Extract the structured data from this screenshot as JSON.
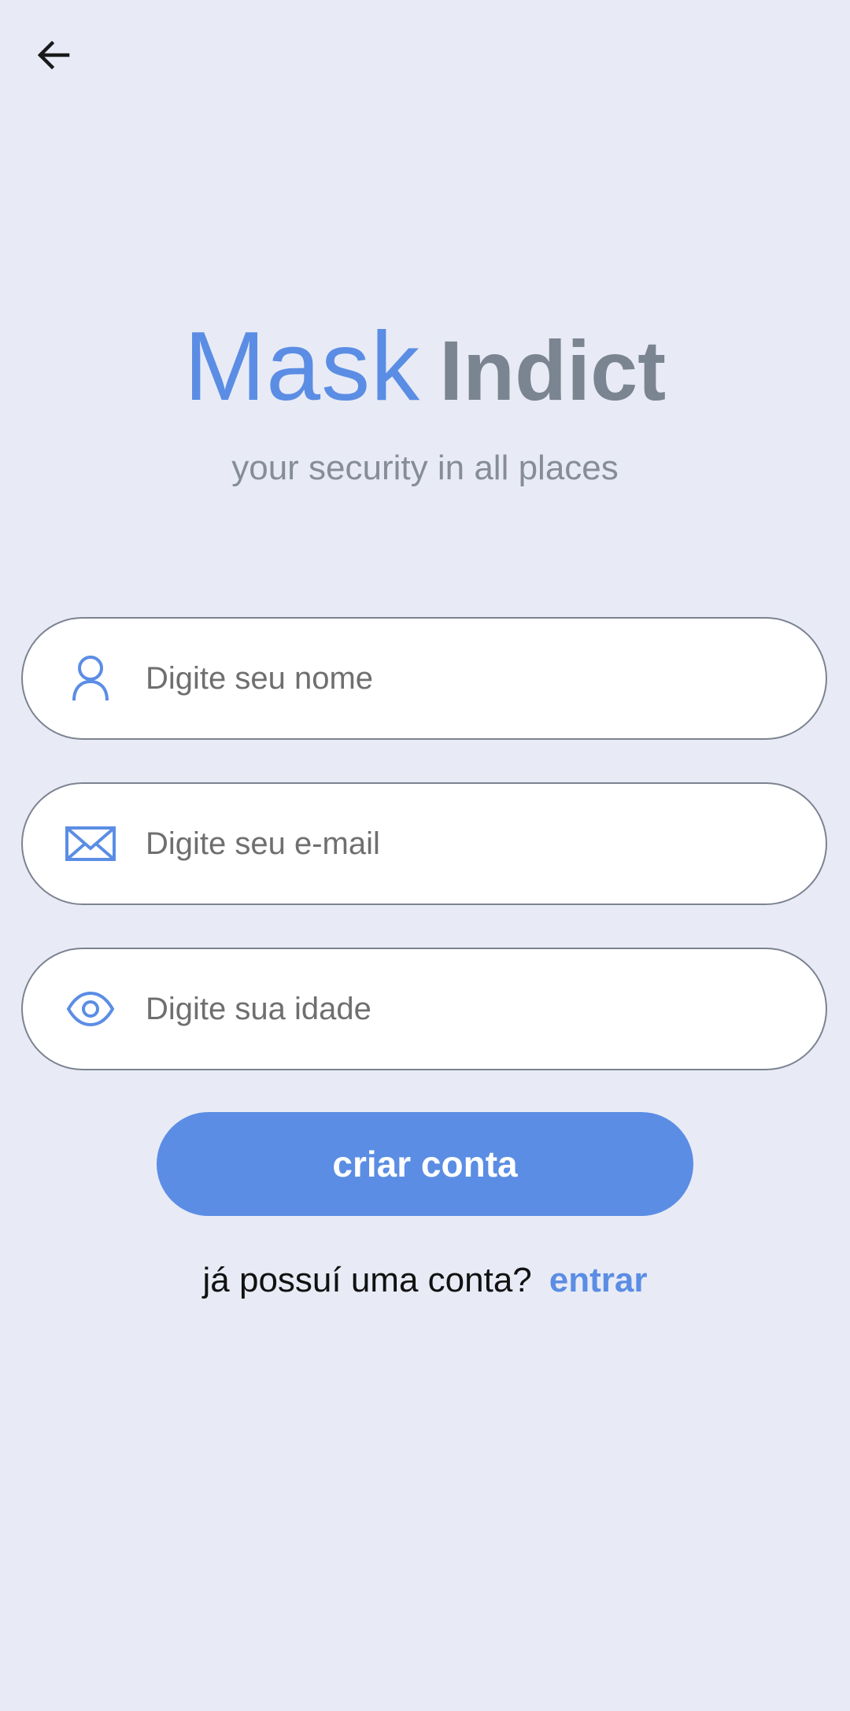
{
  "header": {
    "back_icon": "arrow-left-icon"
  },
  "brand": {
    "part1": "Mask",
    "part2": "Indict",
    "tagline": "your security in all places"
  },
  "form": {
    "name": {
      "placeholder": "Digite seu nome",
      "value": "",
      "icon": "person-icon"
    },
    "email": {
      "placeholder": "Digite seu e-mail",
      "value": "",
      "icon": "mail-icon"
    },
    "age": {
      "placeholder": "Digite sua idade",
      "value": "",
      "icon": "eye-icon"
    },
    "submit_label": "criar conta"
  },
  "footer": {
    "prompt": "já possuí uma conta?",
    "link_label": "entrar"
  },
  "colors": {
    "background": "#e8ebf6",
    "accent": "#5b8de4",
    "secondary_text": "#7b8591",
    "field_border": "#7c8390"
  }
}
